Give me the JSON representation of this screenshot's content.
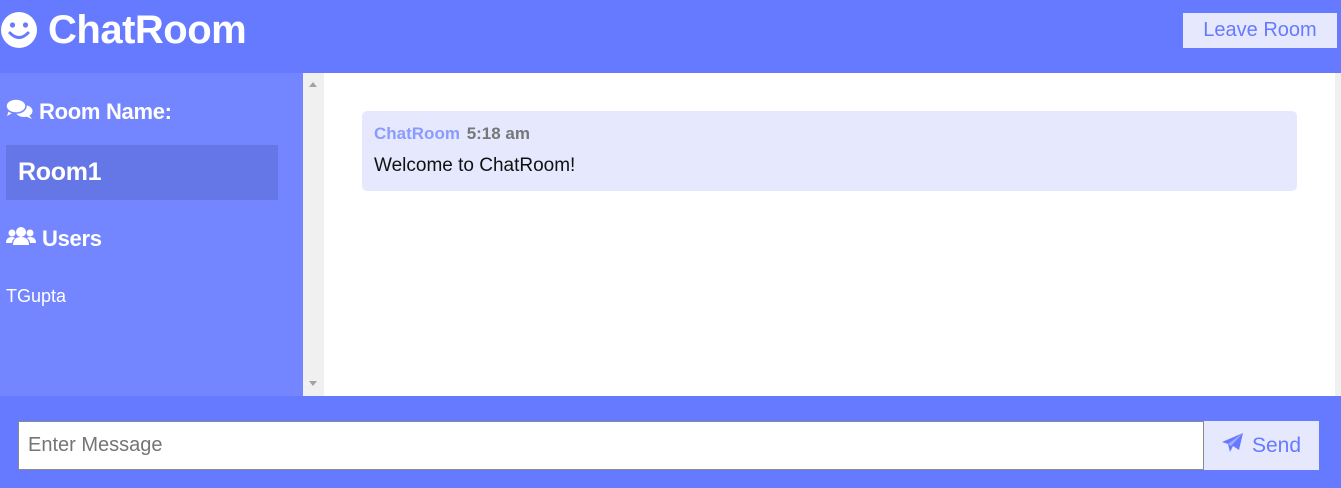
{
  "header": {
    "brand_icon": "smiley-icon",
    "title": "ChatRoom",
    "leave_label": "Leave Room"
  },
  "sidebar": {
    "room_heading": "Room Name:",
    "room_heading_icon": "comments-icon",
    "room_name": "Room1",
    "users_heading": "Users",
    "users_heading_icon": "users-icon",
    "users": [
      "TGupta"
    ]
  },
  "chat": {
    "messages": [
      {
        "user": "ChatRoom",
        "time": "5:18 am",
        "text": "Welcome to ChatRoom!"
      }
    ]
  },
  "composer": {
    "placeholder": "Enter Message",
    "value": "",
    "send_label": "Send",
    "send_icon": "paper-plane-icon"
  },
  "colors": {
    "primary": "#667aff",
    "sidebar": "#7386ff",
    "room_box": "#6576e6",
    "light": "#e6e9fe",
    "username": "#8a9bff"
  }
}
